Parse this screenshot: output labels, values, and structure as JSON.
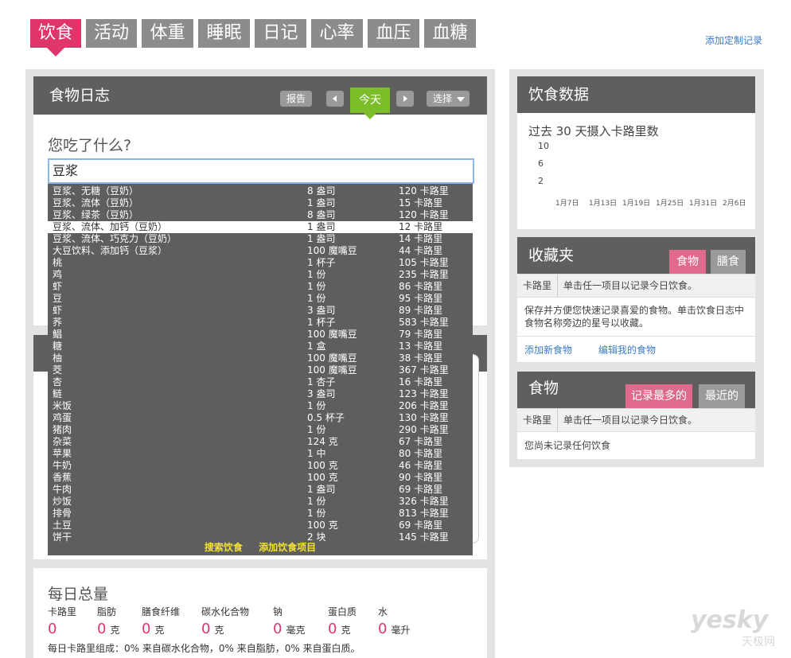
{
  "tabs": [
    {
      "label": "饮食",
      "active": true
    },
    {
      "label": "活动"
    },
    {
      "label": "体重"
    },
    {
      "label": "睡眠"
    },
    {
      "label": "日记"
    },
    {
      "label": "心率"
    },
    {
      "label": "血压"
    },
    {
      "label": "血糖"
    }
  ],
  "add_custom_label": "添加定制记录",
  "food_log": {
    "title": "食物日志",
    "report_label": "报告",
    "prev_icon": "triangle-left-icon",
    "today_label": "今天",
    "next_icon": "triangle-right-icon",
    "select_label": "选择",
    "question": "您吃了什么?",
    "input_value": "豆浆"
  },
  "suggestions": [
    [
      "豆浆、无糖（豆奶）",
      "8 盎司",
      "120 卡路里"
    ],
    [
      "豆浆、流体（豆奶）",
      "1 盎司",
      "15 卡路里"
    ],
    [
      "豆浆、绿茶（豆奶）",
      "8 盎司",
      "120 卡路里"
    ],
    [
      "豆浆、流体、加钙（豆奶）",
      "1 盎司",
      "12 卡路里"
    ],
    [
      "豆浆、流体、巧克力（豆奶）",
      "1 盎司",
      "14 卡路里"
    ],
    [
      "大豆饮料、添加钙（豆浆）",
      "100 魔嘴豆",
      "44 卡路里"
    ],
    [
      "桃",
      "1 杯子",
      "105 卡路里"
    ],
    [
      "鸡",
      "1 份",
      "235 卡路里"
    ],
    [
      "虾",
      "1 份",
      "86 卡路里"
    ],
    [
      "豆",
      "1 份",
      "95 卡路里"
    ],
    [
      "虾",
      "3 盎司",
      "89 卡路里"
    ],
    [
      "荞",
      "1 杯子",
      "583 卡路里"
    ],
    [
      "鲳",
      "100 魔嘴豆",
      "79 卡路里"
    ],
    [
      "糖",
      "1 盒",
      "13 卡路里"
    ],
    [
      "柚",
      "100 魔嘴豆",
      "38 卡路里"
    ],
    [
      "茭",
      "100 魔嘴豆",
      "367 卡路里"
    ],
    [
      "杏",
      "1 杏子",
      "16 卡路里"
    ],
    [
      "鲢",
      "3 盎司",
      "123 卡路里"
    ],
    [
      "米饭",
      "1 份",
      "206 卡路里"
    ],
    [
      "鸡蛋",
      "0.5 杯子",
      "130 卡路里"
    ],
    [
      "猪肉",
      "1 份",
      "290 卡路里"
    ],
    [
      "杂菜",
      "124 克",
      "67 卡路里"
    ],
    [
      "苹果",
      "1 中",
      "80 卡路里"
    ],
    [
      "牛奶",
      "100 克",
      "46 卡路里"
    ],
    [
      "香蕉",
      "100 克",
      "90 卡路里"
    ],
    [
      "牛肉",
      "1 盎司",
      "69 卡路里"
    ],
    [
      "炒饭",
      "1 份",
      "326 卡路里"
    ],
    [
      "排骨",
      "1 份",
      "813 卡路里"
    ],
    [
      "土豆",
      "100 克",
      "69 卡路里"
    ],
    [
      "饼干",
      "2 块",
      "145 卡路里"
    ]
  ],
  "selected_index": 3,
  "suggest_footer": {
    "search_label": "搜索饮食",
    "add_label": "添加饮食项目"
  },
  "daily_totals": {
    "title": "每日总量",
    "labels": [
      "卡路里",
      "脂肪",
      "膳食纤维",
      "碳水化合物",
      "钠",
      "蛋白质",
      "水"
    ],
    "values": [
      {
        "v": "0",
        "u": ""
      },
      {
        "v": "0",
        "u": "克"
      },
      {
        "v": "0",
        "u": "克"
      },
      {
        "v": "0",
        "u": "克"
      },
      {
        "v": "0",
        "u": "毫克"
      },
      {
        "v": "0",
        "u": "克"
      },
      {
        "v": "0",
        "u": "毫升"
      }
    ],
    "summary": "每日卡路里组成：0% 来自碳水化合物，0% 来自脂肪，0% 来自蛋白质。"
  },
  "diet_data": {
    "title": "饮食数据",
    "chart_title": "过去 30 天摄入卡路里数",
    "chart_data": {
      "type": "bar",
      "title": "过去 30 天摄入卡路里数",
      "y_ticks": [
        "10",
        "6",
        "2"
      ],
      "categories": [
        "1月7日",
        "1月13日",
        "1月19日",
        "1月25日",
        "1月31日",
        "2月6日"
      ],
      "values": [
        0,
        0,
        0,
        0,
        0,
        0
      ]
    }
  },
  "favorites": {
    "title": "收藏夹",
    "tab_food": "食物",
    "tab_meal": "膳食",
    "col_cal": "卡路里",
    "col_hint": "单击任一项目以记录今日饮食。",
    "body": "保存并方便您快速记录喜爱的食物。单击饮食日志中食物名称旁边的星号以收藏。",
    "link_add": "添加新食物",
    "link_edit": "编辑我的食物"
  },
  "foods": {
    "title": "食物",
    "tab_most": "记录最多的",
    "tab_recent": "最近的",
    "col_cal": "卡路里",
    "col_hint": "单击任一项目以记录今日饮食。",
    "empty": "您尚未记录任何饮食"
  },
  "watermark": {
    "brand": "yesky",
    "sub": "天极网"
  }
}
